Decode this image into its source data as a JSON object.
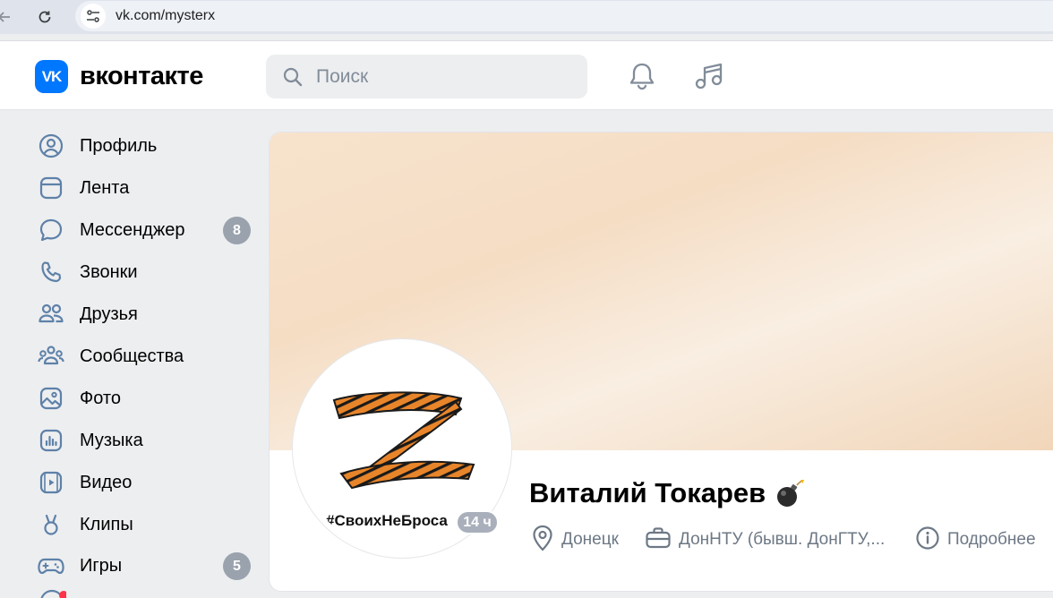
{
  "browser": {
    "url": "vk.com/mysterx",
    "icons": [
      "back-arrow-icon",
      "reload-icon",
      "site-settings-icon"
    ]
  },
  "header": {
    "logo_mark": "VK",
    "logo_text": "вконтакте",
    "search_placeholder": "Поиск",
    "icons": [
      "bell-icon",
      "music-note-icon"
    ]
  },
  "sidebar": {
    "items": [
      {
        "label": "Профиль",
        "icon": "user-circle-icon"
      },
      {
        "label": "Лента",
        "icon": "feed-icon"
      },
      {
        "label": "Мессенджер",
        "icon": "message-bubble-icon",
        "badge": "8"
      },
      {
        "label": "Звонки",
        "icon": "phone-icon"
      },
      {
        "label": "Друзья",
        "icon": "friends-icon"
      },
      {
        "label": "Сообщества",
        "icon": "communities-icon"
      },
      {
        "label": "Фото",
        "icon": "photo-icon"
      },
      {
        "label": "Музыка",
        "icon": "music-icon"
      },
      {
        "label": "Видео",
        "icon": "video-icon"
      },
      {
        "label": "Клипы",
        "icon": "clips-icon"
      },
      {
        "label": "Игры",
        "icon": "gamepad-icon",
        "badge": "5"
      }
    ]
  },
  "profile": {
    "name": "Виталий Токарев",
    "name_emoji": "bomb-icon",
    "avatar_hashtag": "#СвоихНеБроса",
    "online_badge": "14 ч",
    "city": "Донецк",
    "work": "ДонНТУ (бывш. ДонГТУ,...",
    "more": "Подробнее"
  },
  "colors": {
    "accent": "#0077ff",
    "badge": "#99a2ad",
    "icon": "#5e81a8",
    "cover": "#f5ddc4"
  }
}
